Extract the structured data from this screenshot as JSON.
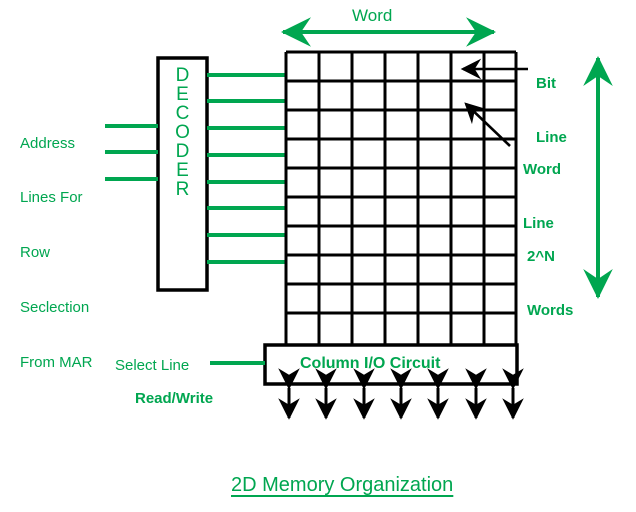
{
  "diagram": {
    "title": "2D Memory Organization",
    "colors": {
      "green": "#00a650",
      "black": "#000000",
      "background": "#ffffff"
    },
    "decoder": {
      "label": "DECODER",
      "letters": [
        "D",
        "E",
        "C",
        "O",
        "D",
        "E",
        "R"
      ],
      "input_line_count": 3,
      "output_line_count": 8
    },
    "address_label": {
      "lines": [
        "Address",
        "Lines For",
        "Row",
        "Seclection",
        "From MAR"
      ],
      "text": "Address Lines For Row Seclection From MAR"
    },
    "memory_array": {
      "columns": 7,
      "rows": 10,
      "top_label": "Word",
      "right_label_lines": [
        "2^N",
        "Words"
      ],
      "right_label": "2^N Words"
    },
    "callouts": {
      "bit_line": "Bit Line",
      "bit_line_lines": [
        "Bit",
        "Line"
      ],
      "word_line": "Word Line",
      "word_line_lines": [
        "Word",
        "Line"
      ]
    },
    "column_io": {
      "label": "Column I/O Circuit",
      "data_arrow_count": 7
    },
    "control_labels": {
      "select_line": "Select Line",
      "read_write": "Read/Write"
    }
  }
}
